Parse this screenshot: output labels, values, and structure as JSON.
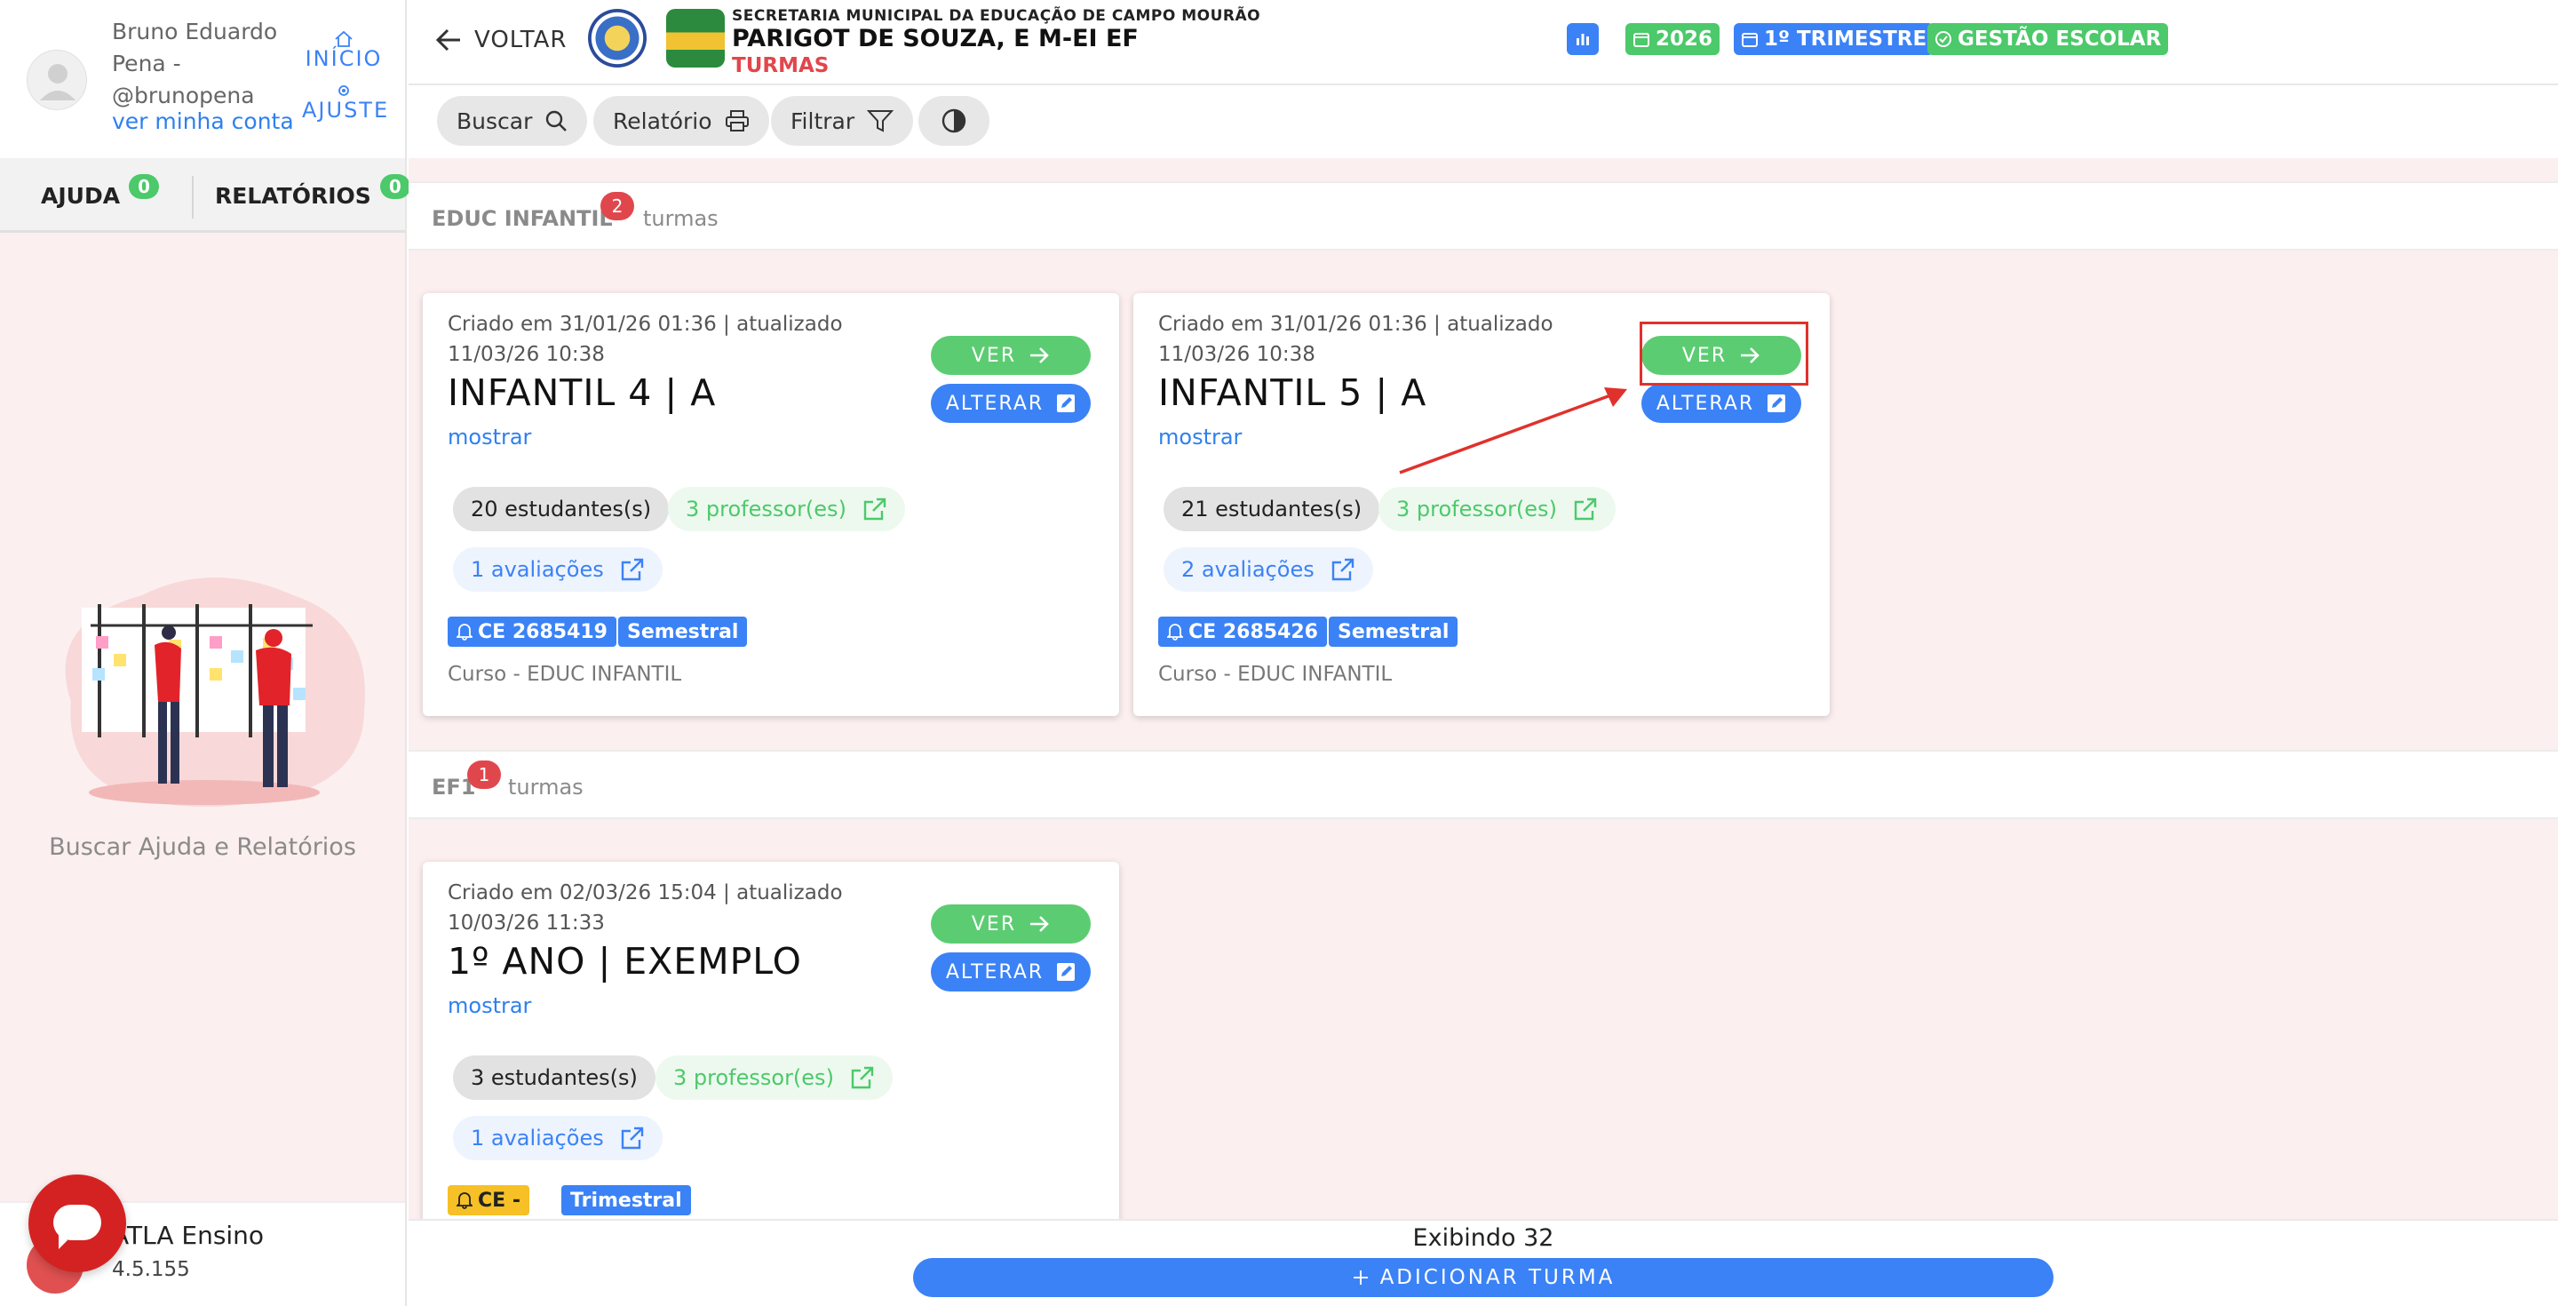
{
  "user": {
    "name": "Bruno Eduardo Pena - @brunopena",
    "account_link": "ver minha conta"
  },
  "sidebar": {
    "nav_home": "INÍCIO",
    "nav_settings": "AJUSTE",
    "tab_help": "AJUDA",
    "tab_help_count": "0",
    "tab_reports": "RELATÓRIOS",
    "tab_reports_count": "0",
    "help_text": "Buscar Ajuda e Relatórios",
    "app_name": "ATLA Ensino",
    "app_version": "4.5.155"
  },
  "header": {
    "back_label": "VOLTAR",
    "secretaria": "SECRETARIA MUNICIPAL DA EDUCAÇÃO DE CAMPO MOURÃO",
    "school": "PARIGOT DE SOUZA, E M-EI EF",
    "section": "TURMAS",
    "year": "2026",
    "term": "1º TRIMESTRE",
    "management": "GESTÃO ESCOLAR"
  },
  "toolbar": {
    "search": "Buscar",
    "report": "Relatório",
    "filter": "Filtrar"
  },
  "sections": [
    {
      "name": "EDUC INFANTIL",
      "count": "2",
      "word": "turmas",
      "cards": [
        {
          "created": "Criado em 31/01/26 01:36 | atualizado 11/03/26 10:38",
          "title": "INFANTIL 4 | A",
          "show": "mostrar",
          "ver": "VER",
          "alterar": "ALTERAR",
          "students": "20 estudantes(s)",
          "teachers": "3 professor(es)",
          "evaluations": "1 avaliações",
          "ce": "CE 2685419",
          "period": "Semestral",
          "course": "Curso - EDUC INFANTIL"
        },
        {
          "created": "Criado em 31/01/26 01:36 | atualizado 11/03/26 10:38",
          "title": "INFANTIL 5 | A",
          "show": "mostrar",
          "ver": "VER",
          "alterar": "ALTERAR",
          "students": "21 estudantes(s)",
          "teachers": "3 professor(es)",
          "evaluations": "2 avaliações",
          "ce": "CE 2685426",
          "period": "Semestral",
          "course": "Curso - EDUC INFANTIL"
        }
      ]
    },
    {
      "name": "EF1",
      "count": "1",
      "word": "turmas",
      "cards": [
        {
          "created": "Criado em 02/03/26 15:04 | atualizado 10/03/26 11:33",
          "title": "1º ANO | EXEMPLO",
          "show": "mostrar",
          "ver": "VER",
          "alterar": "ALTERAR",
          "students": "3 estudantes(s)",
          "teachers": "3 professor(es)",
          "evaluations": "1 avaliações",
          "ce": "CE -",
          "period": "Trimestral"
        }
      ]
    }
  ],
  "footer": {
    "showing": "Exibindo 32",
    "add_button": "ADICIONAR TURMA"
  },
  "colors": {
    "primary_blue": "#3b82f6",
    "success_green": "#5ccc72",
    "badge_red": "#e0474c",
    "annotation_red": "#e0312c",
    "background_pink": "#fcefef"
  }
}
